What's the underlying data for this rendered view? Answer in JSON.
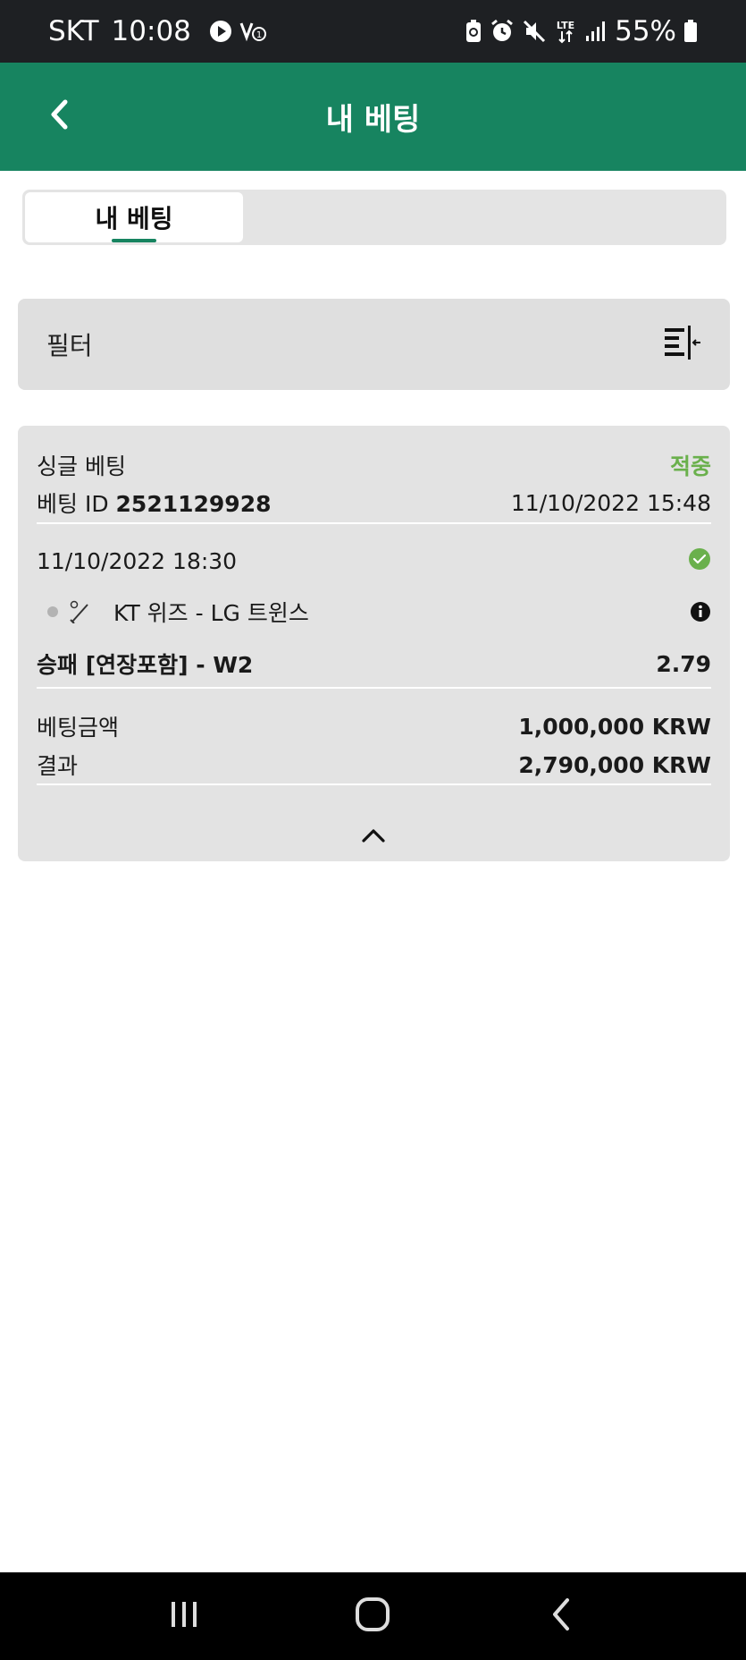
{
  "status_bar": {
    "carrier": "SKT",
    "time": "10:08",
    "network": "LTE",
    "battery": "55%"
  },
  "header": {
    "title": "내 베팅"
  },
  "tabs": [
    {
      "label": "내 베팅",
      "active": true
    }
  ],
  "filter": {
    "label": "필터"
  },
  "bet": {
    "type": "싱글 베팅",
    "status": "적중",
    "id_label": "베팅 ID",
    "id": "2521129928",
    "placed_at": "11/10/2022 15:48",
    "event_time": "11/10/2022 18:30",
    "match": "KT 위즈 - LG 트윈스",
    "selection": "승패 [연장포함] - W2",
    "odds": "2.79",
    "stake_label": "베팅금액",
    "stake": "1,000,000 KRW",
    "result_label": "결과",
    "result": "2,790,000 KRW"
  },
  "colors": {
    "header_green": "#178460",
    "win_green": "#6ab04c",
    "card_bg": "#e3e3e3"
  },
  "icons": {
    "back": "chevron-left-icon",
    "filter": "filter-collapse-icon",
    "won": "check-circle-icon",
    "info": "info-icon",
    "sport": "baseball-icon",
    "collapse": "chevron-up-icon"
  }
}
